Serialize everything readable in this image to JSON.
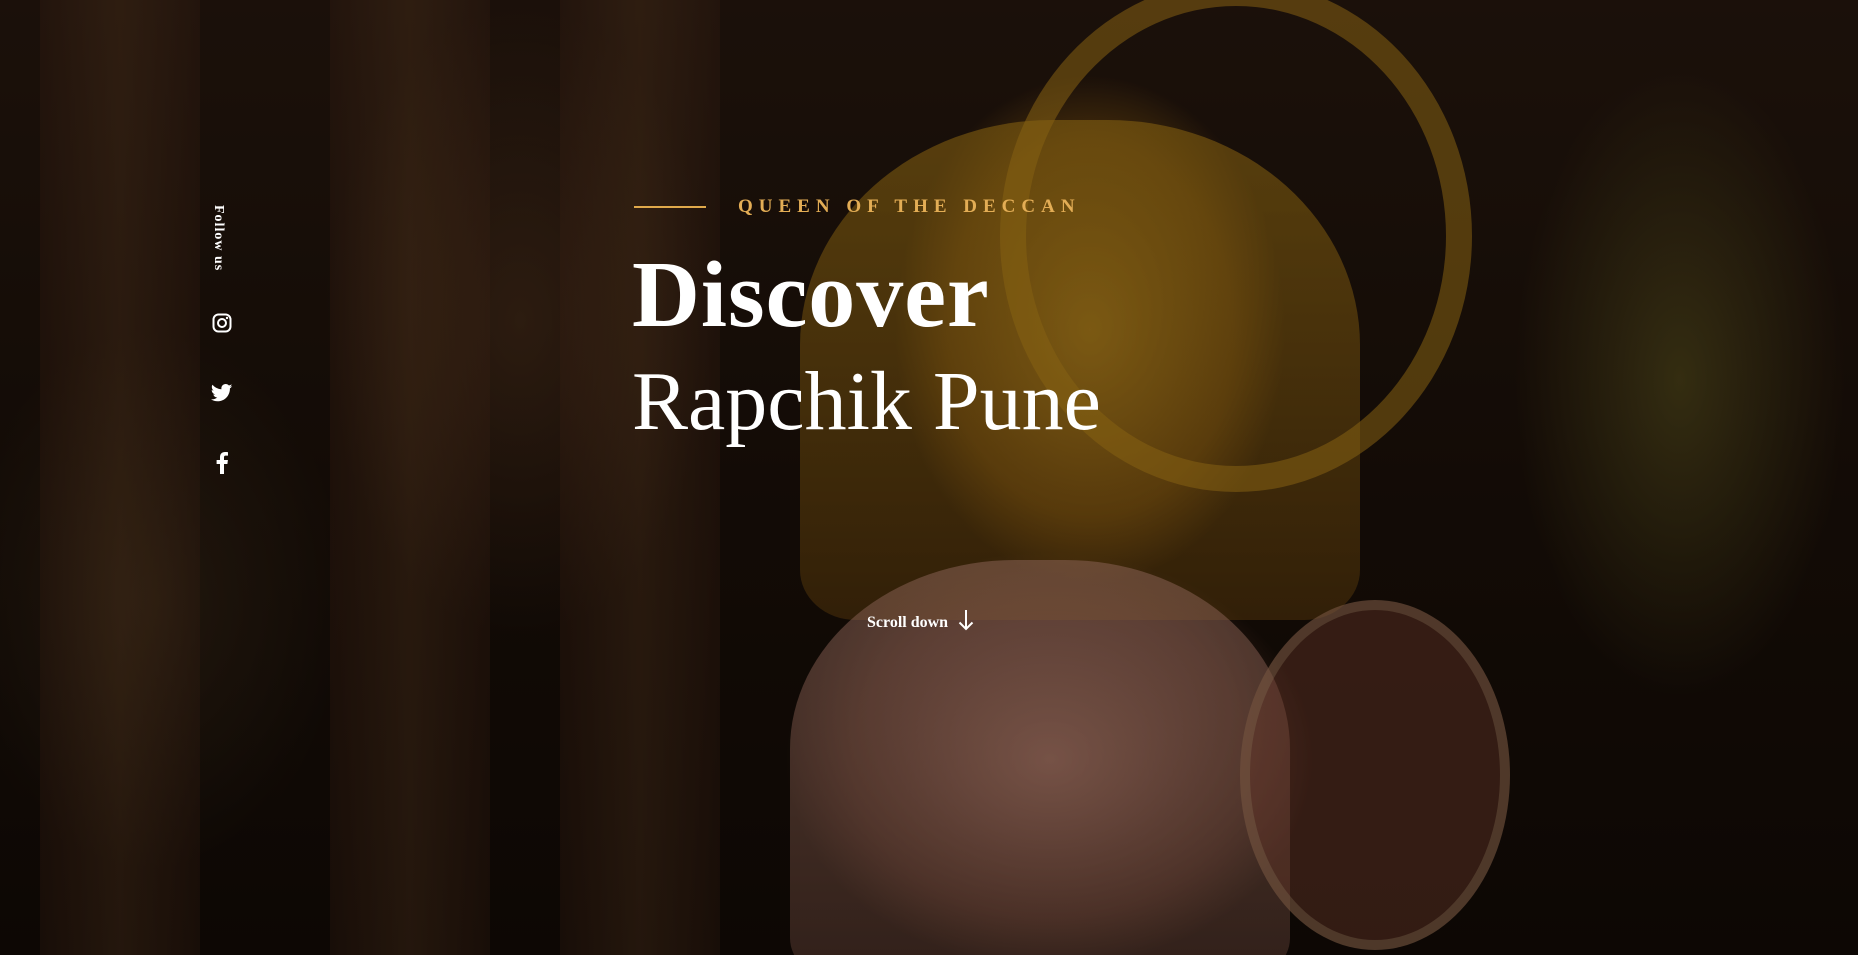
{
  "sidebar": {
    "follow_label": "Follow us",
    "icons": [
      "instagram-icon",
      "twitter-icon",
      "facebook-icon"
    ]
  },
  "hero": {
    "eyebrow": "QUEEN OF THE DECCAN",
    "title_line1": "Discover",
    "title_line2": "Rapchik Pune",
    "scroll_label": "Scroll down",
    "scroll_icon": "arrow-down-icon"
  },
  "colors": {
    "accent": "#e3ad55",
    "text": "#ffffff"
  }
}
